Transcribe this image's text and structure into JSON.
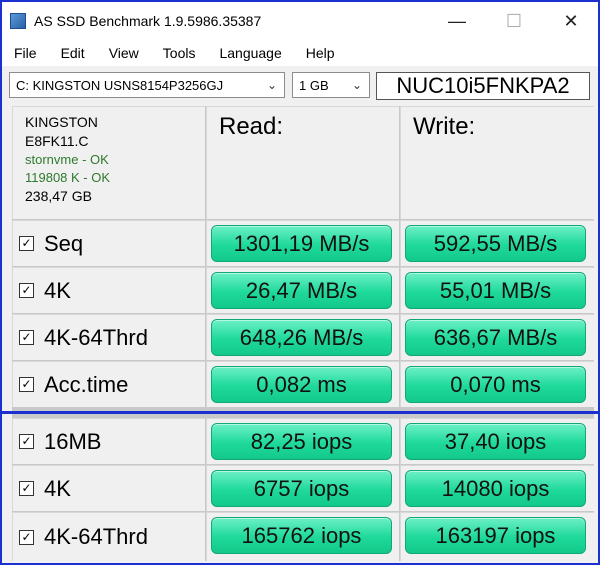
{
  "window": {
    "title": "AS SSD Benchmark 1.9.5986.35387",
    "minimize": "—",
    "maximize": "☐",
    "close": "✕"
  },
  "menu": [
    "File",
    "Edit",
    "View",
    "Tools",
    "Language",
    "Help"
  ],
  "toolbar": {
    "drive": "C: KINGSTON USNS8154P3256GJ",
    "size": "1 GB",
    "pc_name": "NUC10i5FNKPA2"
  },
  "device": {
    "model": "KINGSTON",
    "firmware": "E8FK11.C",
    "driver": "stornvme - OK",
    "alignment": "119808 K - OK",
    "capacity": "238,47 GB"
  },
  "headers": {
    "read": "Read:",
    "write": "Write:"
  },
  "speed_rows": [
    {
      "label": "Seq",
      "read": "1301,19 MB/s",
      "write": "592,55 MB/s"
    },
    {
      "label": "4K",
      "read": "26,47 MB/s",
      "write": "55,01 MB/s"
    },
    {
      "label": "4K-64Thrd",
      "read": "648,26 MB/s",
      "write": "636,67 MB/s"
    },
    {
      "label": "Acc.time",
      "read": "0,082 ms",
      "write": "0,070 ms"
    }
  ],
  "iops_rows": [
    {
      "label": "16MB",
      "read": "82,25 iops",
      "write": "37,40 iops"
    },
    {
      "label": "4K",
      "read": "6757 iops",
      "write": "14080 iops"
    },
    {
      "label": "4K-64Thrd",
      "read": "165762 iops",
      "write": "163197 iops"
    }
  ],
  "checkbox_mark": "✓",
  "colors": {
    "accent_border": "#1c2fd0",
    "result_green": "#1ed99a"
  }
}
